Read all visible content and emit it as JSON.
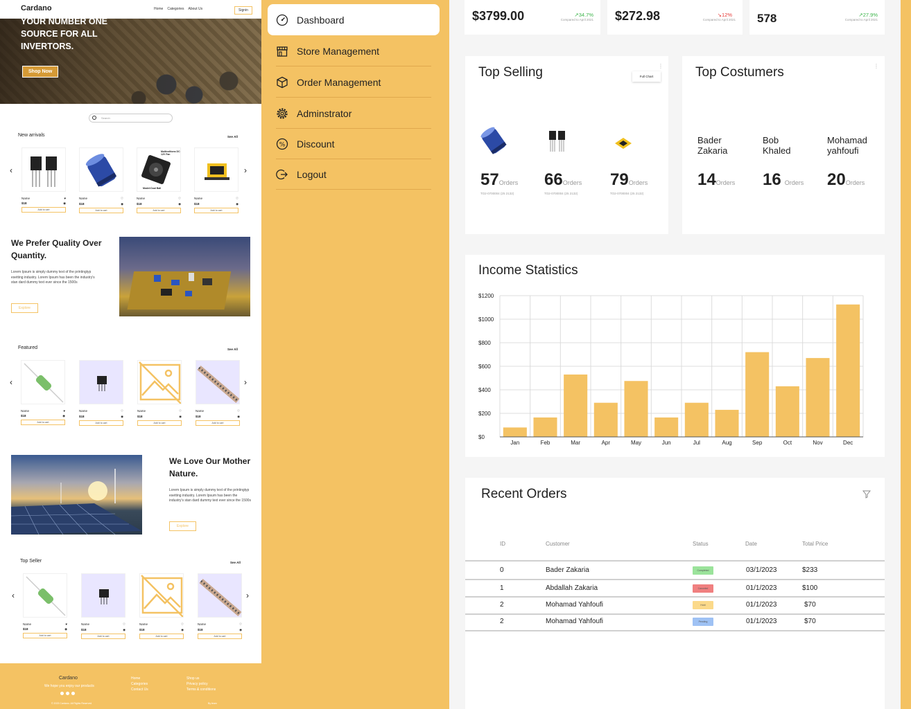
{
  "store": {
    "logo": "Cardano",
    "nav_links": [
      "Home",
      "Categories",
      "About Us"
    ],
    "signin": "Signin",
    "hero_title": "YOUR NUMBER ONE SOURCE FOR ALL INVERTORS.",
    "hero_button": "Shop Now",
    "search_placeholder": "Search",
    "see_all": "See All",
    "product": {
      "name": "Name",
      "price": "$18",
      "add": "Add to cart"
    },
    "sections": {
      "new_arrivals": "New arrivals",
      "featured": "Featured",
      "top_seller": "Top Seller"
    },
    "fan_label_top": "Multivoltions DC 12V Fan",
    "fan_label_bottom": "Model:Dual Ball",
    "quality_title": "We Prefer Quality Over Quantity.",
    "quality_text": "Lorem Ipsum is simply dummy text of the printingtyp esetting industry. Lorem Ipsum has been the industry's stan dard dummy text ever since the 1500s",
    "nature_title": "We Love Our Mother Nature.",
    "nature_text": "Lorem Ipsum is simply dummy text of the printingtyp esetting industry. Lorem Ipsum has been the industry's stan dard dummy text ever since the 1500s",
    "explore": "Explore",
    "footer": {
      "brand": "Cardano",
      "tagline": "We hope you enjoy our products",
      "col1": [
        "Home",
        "Categories",
        "Contact Us"
      ],
      "col2": [
        "Shop us",
        "Privacy policy",
        "Terms & conditions"
      ],
      "copyright": "© 2023 Cardano. All Rights Reserved",
      "credit": "By team"
    }
  },
  "sidebar": {
    "items": [
      {
        "label": "Dashboard",
        "icon": "speedometer-icon",
        "active": true
      },
      {
        "label": "Store Management",
        "icon": "store-icon"
      },
      {
        "label": "Order Management",
        "icon": "box-icon"
      },
      {
        "label": "Adminstrator",
        "icon": "gear-icon"
      },
      {
        "label": "Discount",
        "icon": "discount-icon"
      },
      {
        "label": "Logout",
        "icon": "logout-icon"
      }
    ]
  },
  "stats": [
    {
      "value": "$3799.00",
      "change": "↗34.7%",
      "direction": "up",
      "sub": "Compared to April 2021"
    },
    {
      "value": "$272.98",
      "change": "↘12%",
      "direction": "down",
      "sub": "Compared to April 2021"
    },
    {
      "value": "578",
      "change": "↗27.9%",
      "direction": "up",
      "sub": "Compared to April 2021"
    }
  ],
  "top_selling": {
    "title": "Top Selling",
    "button": "Full Chart",
    "orders_label": "Orders",
    "items": [
      {
        "count": "57",
        "code": "TO2-0700004 (25 2132)"
      },
      {
        "count": "66",
        "code": "TO2-0700004 (25 2132)"
      },
      {
        "count": "79",
        "code": "TO2-0700004 (25 2132)"
      }
    ]
  },
  "top_customers": {
    "title": "Top Costumers",
    "orders_label": "Orders",
    "items": [
      {
        "first": "Bader",
        "last": "Zakaria",
        "count": "14"
      },
      {
        "first": "Bob",
        "last": "Khaled",
        "count": "16"
      },
      {
        "first": "Mohamad",
        "last": "yahfoufi",
        "count": "20"
      }
    ]
  },
  "income": {
    "title": "Income Statistics",
    "bar_color": "#f4c263"
  },
  "chart_data": {
    "type": "bar",
    "categories": [
      "Jan",
      "Feb",
      "Mar",
      "Apr",
      "May",
      "Jun",
      "Jul",
      "Aug",
      "Sep",
      "Oct",
      "Nov",
      "Dec"
    ],
    "values": [
      80,
      165,
      530,
      290,
      475,
      165,
      290,
      230,
      720,
      430,
      670,
      1125
    ],
    "title": "Income Statistics",
    "ylim": [
      0,
      1200
    ],
    "yticks": [
      "$0",
      "$200",
      "$400",
      "$600",
      "$800",
      "$1000",
      "$1200"
    ],
    "grid": true
  },
  "recent_orders": {
    "title": "Recent Orders",
    "columns": [
      "ID",
      "Customer",
      "Status",
      "Date",
      "Total Price"
    ],
    "rows": [
      {
        "id": "0",
        "customer": "Bader Zakaria",
        "status": "Completed",
        "status_color": "#9be39b",
        "date": "03/1/2023",
        "price": "$233"
      },
      {
        "id": "1",
        "customer": "Abdallah Zakaria",
        "status": "Canceled",
        "status_color": "#f08080",
        "date": "01/1/2023",
        "price": "$100"
      },
      {
        "id": "2",
        "customer": "Mohamad Yahfoufi",
        "status": "Hold",
        "status_color": "#fbd98a",
        "date": "01/1/2023",
        "price": "$70"
      },
      {
        "id": "2",
        "customer": "Mohamad Yahfoufi",
        "status": "Pending",
        "status_color": "#9fc2f4",
        "date": "01/1/2023",
        "price": "$70"
      }
    ]
  },
  "colors": {
    "accent": "#f4c263",
    "up": "#3cb44b",
    "down": "#e53935"
  }
}
